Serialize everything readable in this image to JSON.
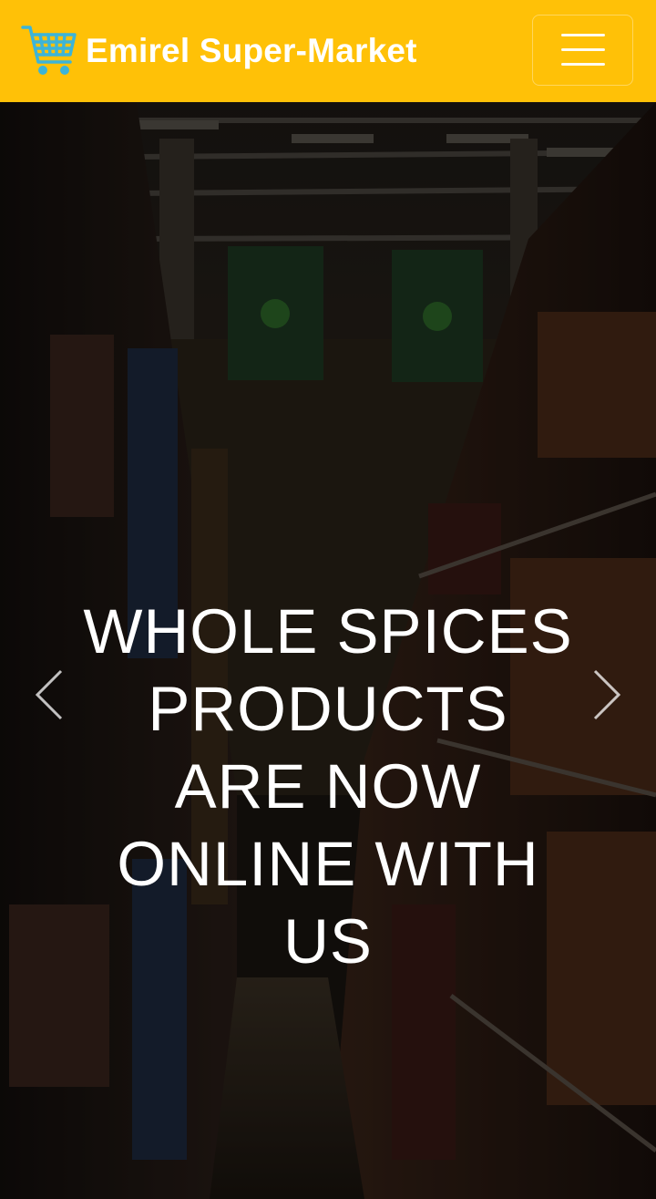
{
  "navbar": {
    "brand_name": "Emirel Super-Market",
    "brand_icon": "shopping-cart-icon",
    "toggler_icon": "hamburger-menu-icon",
    "background_color": "#ffc107",
    "cart_color": "#3cb4d8"
  },
  "carousel": {
    "active_slide_caption": "WHOLE SPICES PRODUCTS ARE NOW ONLINE WITH US",
    "prev_icon": "chevron-left-icon",
    "next_icon": "chevron-right-icon"
  }
}
